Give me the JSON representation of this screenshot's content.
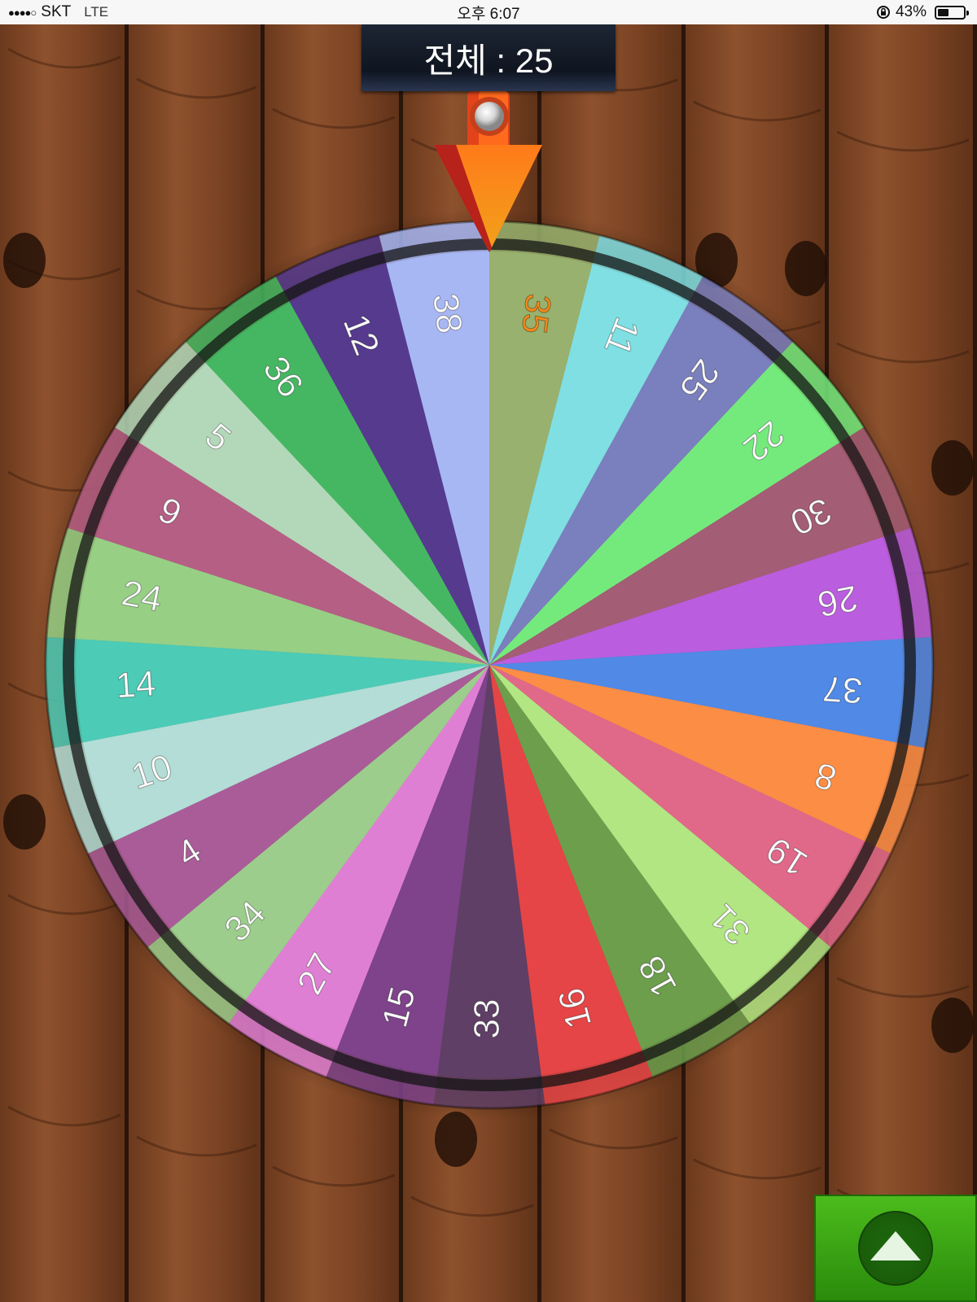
{
  "status_bar": {
    "signal": "●●●●○",
    "carrier": "SKT",
    "network": "LTE",
    "time": "오후 6:07",
    "battery_percent": "43%",
    "battery_level": 0.43
  },
  "total": {
    "text": "전체 : 25"
  },
  "wheel": {
    "segments": [
      {
        "label": "35",
        "color": "#98b16e",
        "label_color": "#f28a1c"
      },
      {
        "label": "11",
        "color": "#7fdfe3",
        "label_color": "#ffffff"
      },
      {
        "label": "25",
        "color": "#7a7fbd",
        "label_color": "#ffffff"
      },
      {
        "label": "22",
        "color": "#74ea7d",
        "label_color": "#ffffff"
      },
      {
        "label": "30",
        "color": "#a35d74",
        "label_color": "#ffffff"
      },
      {
        "label": "26",
        "color": "#bb5ddf",
        "label_color": "#ffffff"
      },
      {
        "label": "37",
        "color": "#5089e6",
        "label_color": "#ffffff"
      },
      {
        "label": "8",
        "color": "#fb8d45",
        "label_color": "#ffffff"
      },
      {
        "label": "19",
        "color": "#e06889",
        "label_color": "#ffffff"
      },
      {
        "label": "31",
        "color": "#b1e683",
        "label_color": "#ffffff"
      },
      {
        "label": "18",
        "color": "#6c9e4c",
        "label_color": "#ffffff"
      },
      {
        "label": "16",
        "color": "#e54546",
        "label_color": "#ffffff"
      },
      {
        "label": "33",
        "color": "#5f3f65",
        "label_color": "#ffffff"
      },
      {
        "label": "15",
        "color": "#7e438a",
        "label_color": "#ffffff"
      },
      {
        "label": "27",
        "color": "#df7fd4",
        "label_color": "#ffffff"
      },
      {
        "label": "34",
        "color": "#9ccd8c",
        "label_color": "#ffffff"
      },
      {
        "label": "4",
        "color": "#a95c98",
        "label_color": "#ffffff"
      },
      {
        "label": "10",
        "color": "#b3ddd6",
        "label_color": "#ffffff"
      },
      {
        "label": "14",
        "color": "#4ccbb6",
        "label_color": "#ffffff"
      },
      {
        "label": "24",
        "color": "#97cf85",
        "label_color": "#ffffff"
      },
      {
        "label": "9",
        "color": "#b55f85",
        "label_color": "#ffffff"
      },
      {
        "label": "5",
        "color": "#b3d8b9",
        "label_color": "#ffffff"
      },
      {
        "label": "36",
        "color": "#45b762",
        "label_color": "#ffffff"
      },
      {
        "label": "12",
        "color": "#553a8e",
        "label_color": "#ffffff"
      },
      {
        "label": "38",
        "color": "#a7b7f4",
        "label_color": "#ffffff"
      }
    ]
  },
  "spin_button": {
    "icon": "up-triangle-icon"
  },
  "pointer": {
    "icon": "down-arrow-pointer-icon"
  }
}
